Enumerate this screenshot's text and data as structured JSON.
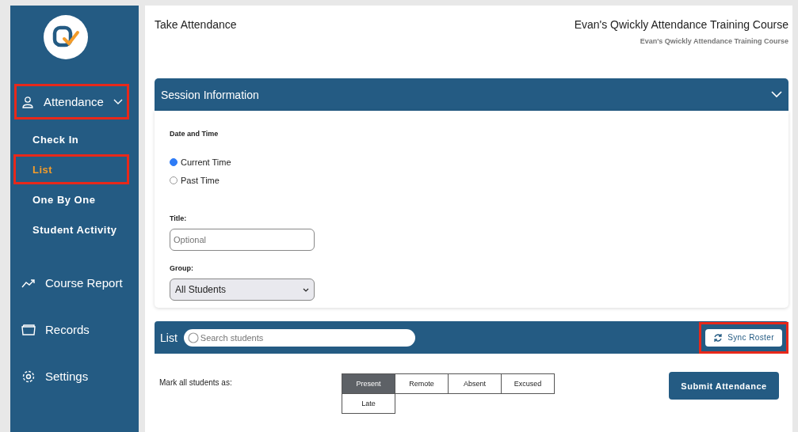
{
  "sidebar": {
    "items": [
      {
        "label": "Attendance",
        "kind": "person",
        "expanded": true,
        "highlighted": true,
        "children": [
          {
            "label": "Check In",
            "selected": false,
            "highlighted": false
          },
          {
            "label": "List",
            "selected": true,
            "highlighted": true
          },
          {
            "label": "One By One",
            "selected": false,
            "highlighted": false
          },
          {
            "label": "Student Activity",
            "selected": false,
            "highlighted": false
          }
        ]
      },
      {
        "label": "Course Report",
        "kind": "trend",
        "highlighted": false
      },
      {
        "label": "Records",
        "kind": "folder",
        "highlighted": false
      },
      {
        "label": "Settings",
        "kind": "gear",
        "highlighted": false
      }
    ]
  },
  "header": {
    "page_title": "Take Attendance",
    "course": "Evan's Qwickly Attendance Training Course",
    "course_subtitle": "Evan's Qwickly Attendance Training Course"
  },
  "session": {
    "title": "Session Information",
    "expanded": true,
    "date_label": "Date and Time",
    "time_options": [
      {
        "label": "Current Time",
        "selected": true
      },
      {
        "label": "Past Time",
        "selected": false
      }
    ],
    "title_label": "Title:",
    "title_field": {
      "placeholder": "Optional"
    },
    "group_label": "Group:",
    "group_select": {
      "value": "All Students"
    }
  },
  "list": {
    "title": "List",
    "search": {
      "placeholder": "Search students"
    },
    "sync_button": {
      "label": "Sync Roster",
      "highlighted": true
    },
    "mark_label": "Mark all students as:",
    "statuses": [
      {
        "label": "Present",
        "selected": true
      },
      {
        "label": "Remote",
        "selected": false
      },
      {
        "label": "Absent",
        "selected": false
      },
      {
        "label": "Excused",
        "selected": false
      },
      {
        "label": "Late",
        "selected": false
      }
    ],
    "submit": "Submit Attendance"
  }
}
